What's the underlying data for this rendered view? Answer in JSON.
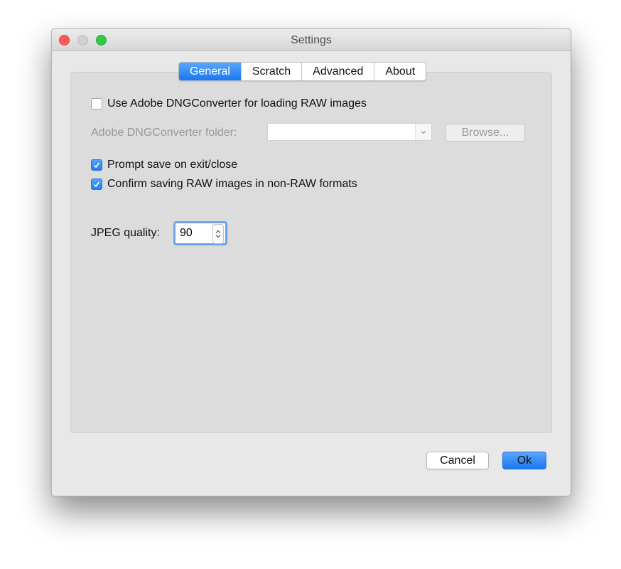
{
  "window": {
    "title": "Settings",
    "controls": [
      "close",
      "minimize",
      "zoom"
    ]
  },
  "tabs": [
    {
      "label": "General",
      "active": true
    },
    {
      "label": "Scratch",
      "active": false
    },
    {
      "label": "Advanced",
      "active": false
    },
    {
      "label": "About",
      "active": false
    }
  ],
  "general": {
    "use_dng": {
      "label": "Use Adobe DNGConverter for loading RAW images",
      "checked": false
    },
    "dng_folder": {
      "label": "Adobe DNGConverter folder:",
      "value": "",
      "enabled": false
    },
    "browse_label": "Browse...",
    "prompt_save": {
      "label": "Prompt save on exit/close",
      "checked": true
    },
    "confirm_raw": {
      "label": "Confirm saving RAW images in non-RAW formats",
      "checked": true
    },
    "jpeg_quality": {
      "label": "JPEG quality:",
      "value": "90"
    }
  },
  "buttons": {
    "cancel": "Cancel",
    "ok": "Ok"
  },
  "colors": {
    "accent": "#1a78f2",
    "close": "#fc5b57",
    "zoom": "#34c84a"
  }
}
